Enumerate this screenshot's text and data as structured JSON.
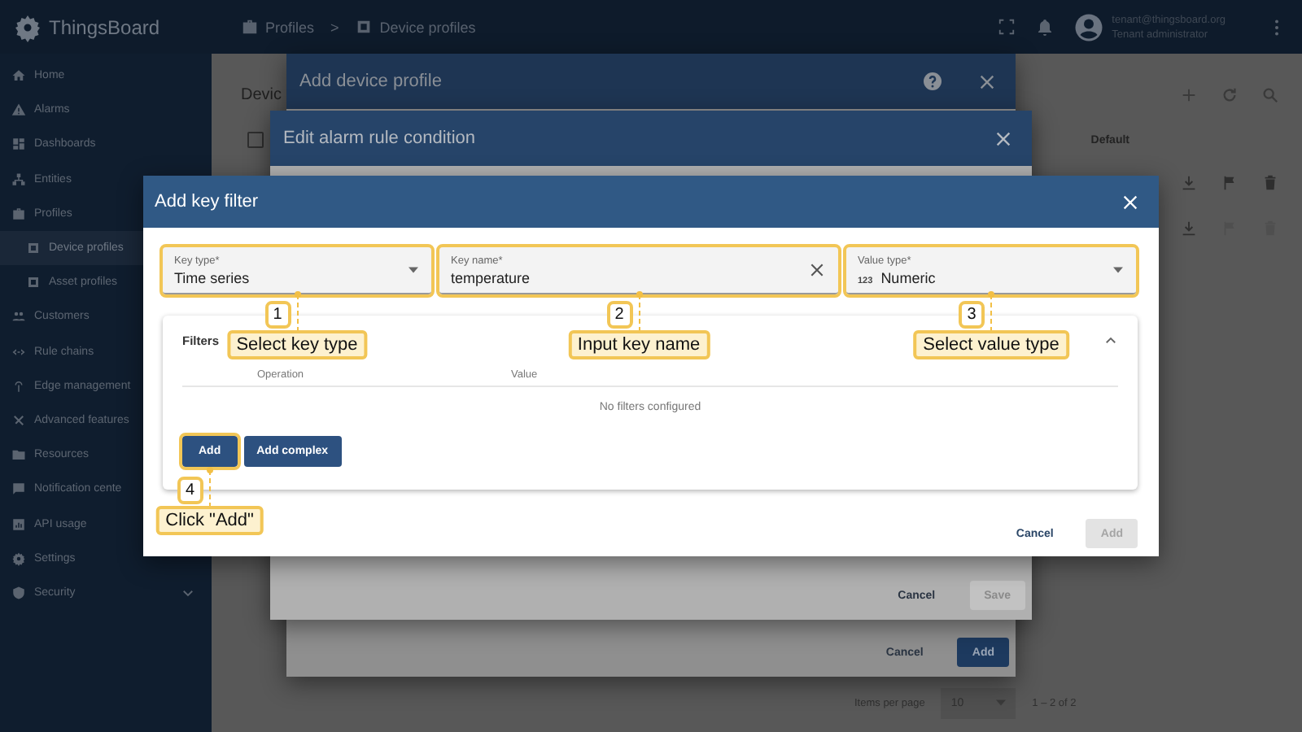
{
  "topbar": {
    "logo": "ThingsBoard",
    "breadcrumbs": [
      "Profiles",
      "Device profiles"
    ],
    "separator": ">",
    "user": {
      "email": "tenant@thingsboard.org",
      "role": "Tenant administrator"
    }
  },
  "sidebar": {
    "items": [
      {
        "label": "Home",
        "selected": false
      },
      {
        "label": "Alarms",
        "selected": false
      },
      {
        "label": "Dashboards",
        "selected": false
      },
      {
        "label": "Entities",
        "selected": false
      },
      {
        "label": "Profiles",
        "selected": false,
        "children": [
          {
            "label": "Device profiles",
            "selected": true
          },
          {
            "label": "Asset profiles",
            "selected": false
          }
        ]
      },
      {
        "label": "Customers",
        "selected": false
      },
      {
        "label": "Rule chains",
        "selected": false
      },
      {
        "label": "Edge management",
        "selected": false
      },
      {
        "label": "Advanced features",
        "selected": false
      },
      {
        "label": "Resources",
        "selected": false
      },
      {
        "label": "Notification cente",
        "selected": false
      },
      {
        "label": "API usage",
        "selected": false
      },
      {
        "label": "Settings",
        "selected": false
      },
      {
        "label": "Security",
        "selected": false,
        "expanded": false
      }
    ]
  },
  "page": {
    "title": "Devic",
    "select_all_checked": false,
    "column": "Default",
    "items_per_page_label": "Items per page",
    "per_page": "10",
    "range": "1 – 2 of 2"
  },
  "device_profile_dialog": {
    "title": "Add device profile",
    "buttons": [
      {
        "label": "Cancel",
        "kind": "text",
        "disabled": false
      },
      {
        "label": "Add",
        "kind": "raised",
        "disabled": false
      }
    ]
  },
  "alarm_condition_dialog": {
    "title": "Edit alarm rule condition",
    "buttons": [
      {
        "label": "Cancel",
        "kind": "text",
        "disabled": false
      },
      {
        "label": "Save",
        "kind": "raised",
        "disabled": true
      }
    ]
  },
  "key_filter_dialog": {
    "title": "Add key filter",
    "fields": [
      {
        "kind": "select",
        "label": "Key type*",
        "value": "Time series",
        "highlighted": true,
        "callout": {
          "number": "1",
          "text": "Select key type"
        }
      },
      {
        "kind": "text",
        "label": "Key name*",
        "value": "temperature",
        "highlighted": true,
        "callout": {
          "number": "2",
          "text": "Input key name"
        }
      },
      {
        "kind": "select",
        "label": "Value type*",
        "prefix": "123",
        "value": "Numeric",
        "highlighted": true,
        "callout": {
          "number": "3",
          "text": "Select value type"
        }
      }
    ],
    "filters": {
      "title": "Filters",
      "expanded": true,
      "columns": [
        "Operation",
        "Value"
      ],
      "empty": "No filters configured",
      "buttons": [
        {
          "label": "Add",
          "highlighted": true,
          "callout": {
            "number": "4",
            "text": "Click \"Add\""
          }
        },
        {
          "label": "Add complex",
          "highlighted": false
        }
      ]
    },
    "buttons": [
      {
        "label": "Cancel",
        "kind": "text",
        "disabled": false
      },
      {
        "label": "Add",
        "kind": "raised",
        "disabled": true
      }
    ]
  }
}
